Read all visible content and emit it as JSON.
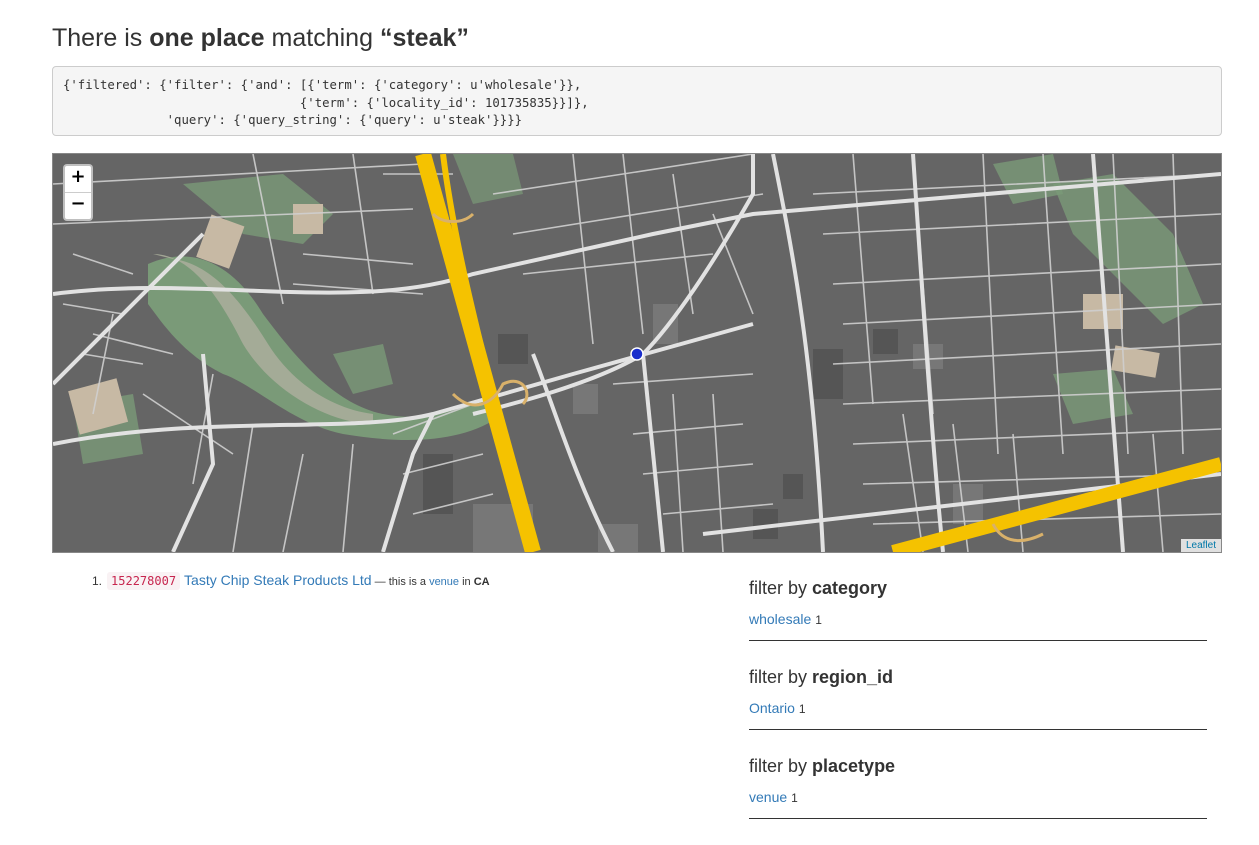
{
  "heading": {
    "pre": "There is ",
    "bold1": "one place",
    "mid": " matching ",
    "bold2": "“steak”"
  },
  "query_text": "{'filtered': {'filter': {'and': [{'term': {'category': u'wholesale'}},\n                                {'term': {'locality_id': 101735835}}]},\n              'query': {'query_string': {'query': u'steak'}}}}",
  "map": {
    "zoom_in": "+",
    "zoom_out": "−",
    "attribution": "Leaflet",
    "colors": {
      "background": "#656565",
      "roads": "#d8d8d8",
      "highway": "#f5c200",
      "park": "#7a9a78",
      "marker": "#1a2ecc"
    }
  },
  "results": [
    {
      "num": "1.",
      "id": "152278007",
      "name": "Tasty Chip Steak Products Ltd",
      "sep": " — this is a ",
      "type": "venue",
      "in": " in ",
      "country": "CA"
    }
  ],
  "filters": [
    {
      "label": "filter by ",
      "field": "category",
      "value": "wholesale",
      "count": "1"
    },
    {
      "label": "filter by ",
      "field": "region_id",
      "value": "Ontario",
      "count": "1"
    },
    {
      "label": "filter by ",
      "field": "placetype",
      "value": "venue",
      "count": "1"
    }
  ]
}
